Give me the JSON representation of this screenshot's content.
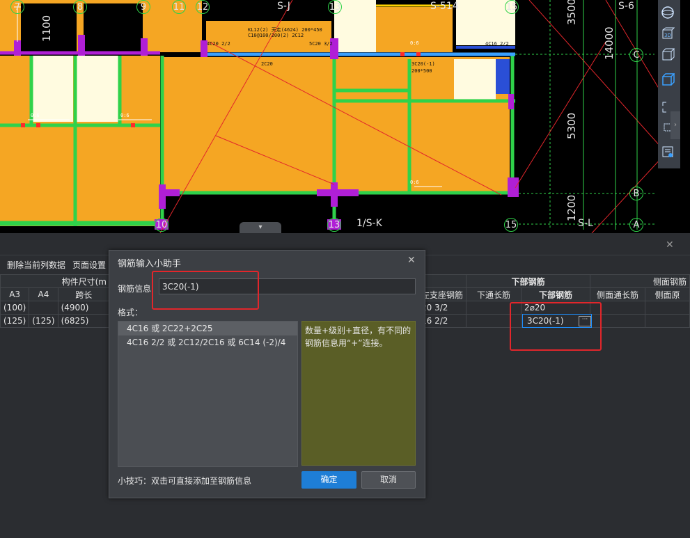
{
  "cad": {
    "grid_top": [
      "7",
      "8",
      "9",
      "11",
      "12",
      "S-J",
      "1/S-K",
      "13",
      "S-514",
      "15",
      "S-6"
    ],
    "grid_bottom": [
      "10",
      "13",
      "1/S-K",
      "15",
      "S-L"
    ],
    "grid_right": [
      "C",
      "B",
      "A"
    ],
    "dim_left": "1100",
    "dim_right": [
      "3500",
      "14000",
      "5300",
      "1200"
    ],
    "beam_text": [
      "KL12(2) 天走(4624) 200*450",
      "C10@100/200(2) 2C12",
      "4C20 2/2",
      "5C20 3/2",
      "2C20",
      "3C20(-1)",
      "200*500",
      "4C16 2/2",
      "0:6",
      "0:6",
      "0:6",
      "0:6"
    ]
  },
  "toolstrip": {
    "icons": [
      "sphere-icon",
      "3d-view-icon",
      "cube-icon",
      "cube-blue-icon",
      "select-region-icon",
      "select-cube-icon",
      "properties-icon"
    ]
  },
  "panel": {
    "toolbar": {
      "delete_label": "删除当前列数据",
      "page_setup_label": "页面设置"
    },
    "headers": {
      "component_size": "构件尺寸(m",
      "bottom_rebar_group": "下部钢筋",
      "side_rebar_group": "侧面钢筋",
      "a3": "A3",
      "a4": "A4",
      "span": "跨长",
      "left_support": "左支座钢筋",
      "bottom_through": "下通长筋",
      "bottom_rebar": "下部钢筋",
      "side_through": "侧面通长筋",
      "side_orig": "侧面原"
    },
    "rows": [
      {
        "a3": "(100)",
        "a4": "",
        "span": "(4900)",
        "support": "20 3/2",
        "bottom": "2⌀20"
      },
      {
        "a3": "(125)",
        "a4": "(125)",
        "span": "(6825)",
        "support": "16 2/2",
        "bottom": "3C20(-1)"
      }
    ]
  },
  "dialog": {
    "title": "钢筋输入小助手",
    "info_label": "钢筋信息",
    "info_value": "3C20(-1)",
    "format_label": "格式：",
    "formats": [
      "4C16 或 2C22+2C25",
      "4C16 2/2 或 2C12/2C16 或 6C14 (-2)/4"
    ],
    "description": "数量+级别+直径，有不同的钢筋信息用“+”连接。",
    "tip": "小技巧：双击可直接添加至钢筋信息",
    "ok": "确定",
    "cancel": "取消"
  },
  "colors": {
    "slab": "#f5a623",
    "beam_green": "#2fd24a",
    "column_purple": "#b01fd6",
    "accent_blue": "#1e7ed6",
    "red_highlight": "#e2262b"
  }
}
